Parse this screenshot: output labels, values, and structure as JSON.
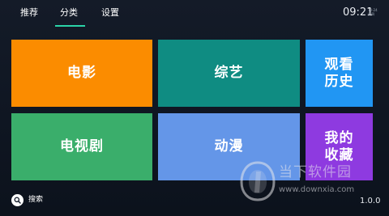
{
  "nav": {
    "tabs": [
      {
        "label": "推荐"
      },
      {
        "label": "分类"
      },
      {
        "label": "设置"
      }
    ],
    "active_tab": "分类"
  },
  "status": {
    "time": "09:21",
    "date_small": "10-24 周四"
  },
  "tiles": {
    "movie": {
      "label": "电影",
      "color": "#fb8c00"
    },
    "variety": {
      "label": "综艺",
      "color": "#0f8c82"
    },
    "history": {
      "label": "观看历史",
      "color": "#2196f3"
    },
    "tv": {
      "label": "电视剧",
      "color": "#3aae6b"
    },
    "anime": {
      "label": "动漫",
      "color": "#6496e8"
    },
    "mine": {
      "label": "我的收藏",
      "color": "#8e3ae0"
    }
  },
  "footer": {
    "search_label": "搜索",
    "search_icon": "search-icon",
    "version": "1.0.0"
  },
  "watermark": {
    "title": "当下软件园",
    "url": "www.downxia.com"
  },
  "colors": {
    "background": "#0f1521",
    "accent": "#2bd4a8"
  }
}
